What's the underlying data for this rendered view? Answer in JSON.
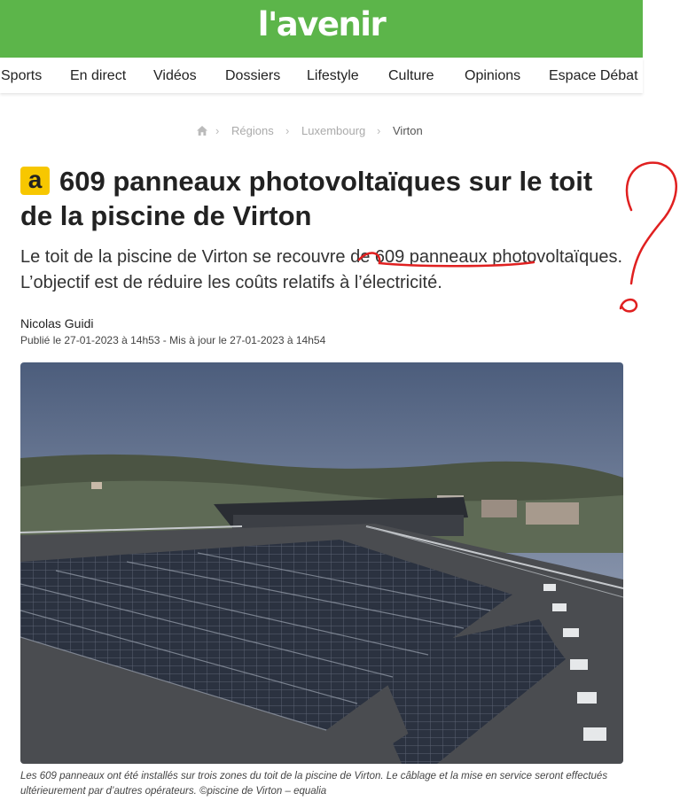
{
  "header": {
    "logo_text": "l'avenir",
    "brand_color": "#5cb54a"
  },
  "nav": {
    "items": [
      "Sports",
      "En direct",
      "Vidéos",
      "Dossiers",
      "Lifestyle",
      "Culture",
      "Opinions",
      "Espace Débat"
    ]
  },
  "breadcrumb": {
    "home_icon": "home-icon",
    "items": [
      "Régions",
      "Luxembourg",
      "Virton"
    ]
  },
  "article": {
    "badge": "a",
    "badge_color": "#f7c700",
    "title": "609 panneaux photovoltaïques sur le toit de la piscine de Virton",
    "chapo": "Le toit de la piscine de Virton se recouvre de 609 panneaux photovoltaïques. L’objectif est de réduire les coûts relatifs à l’électricité.",
    "author": "Nicolas Guidi",
    "dates": "Publié le 27-01-2023 à 14h53 - Mis à jour le 27-01-2023 à 14h54",
    "photo_alt": "Panneaux photovoltaïques sur le toit de la piscine de Virton",
    "caption": "Les 609 panneaux ont été installés sur trois zones du toit de la piscine de Virton. Le câblage et la mise en service seront effectués ultérieurement par d’autres opérateurs. ©piscine de Virton – equalia"
  },
  "annotation": {
    "color": "#e02020"
  }
}
